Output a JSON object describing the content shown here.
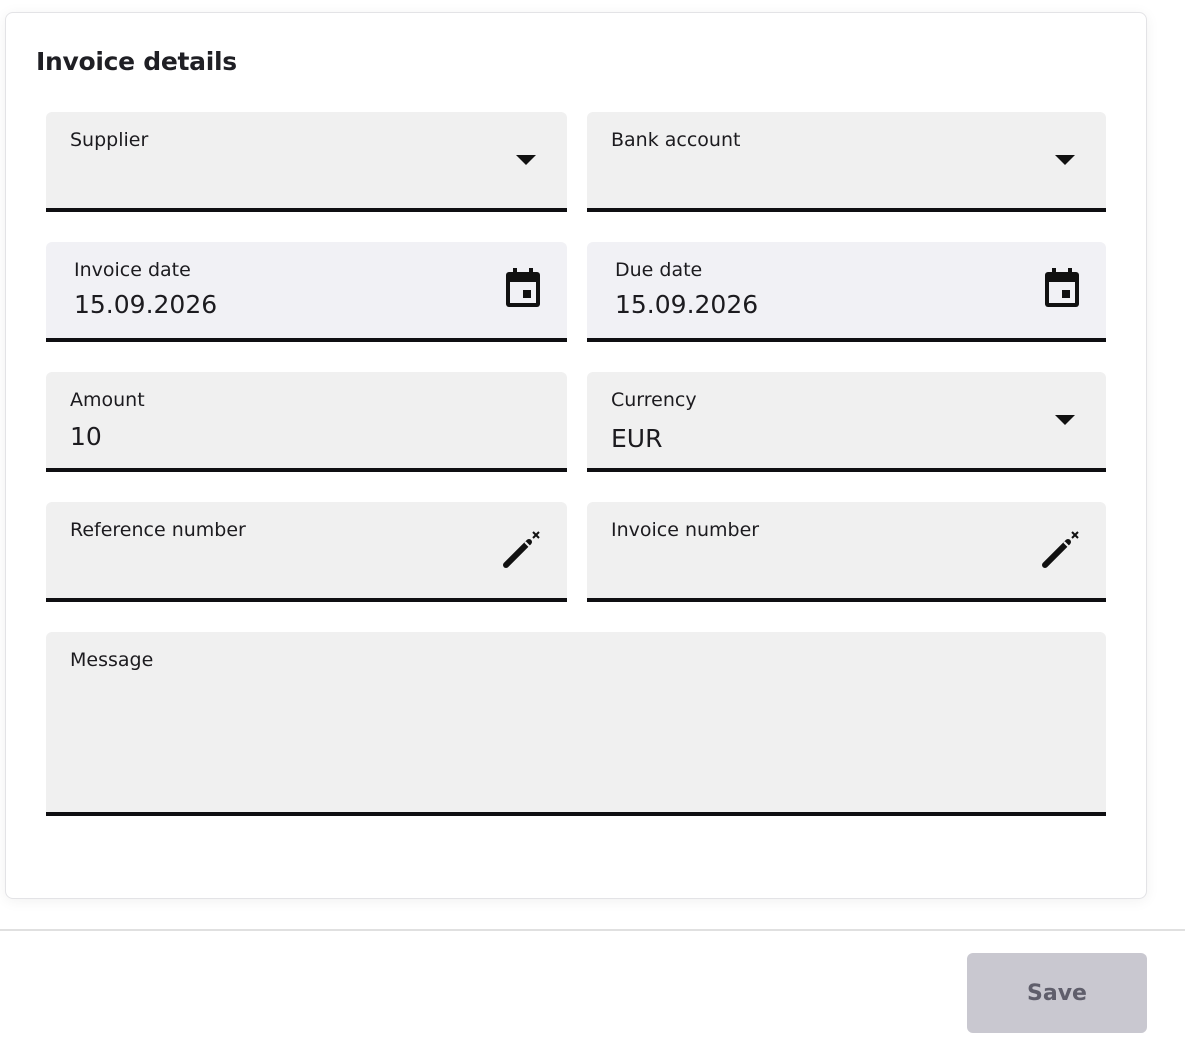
{
  "form": {
    "title": "Invoice details",
    "supplier": {
      "label": "Supplier",
      "value": ""
    },
    "bank_account": {
      "label": "Bank account",
      "value": ""
    },
    "invoice_date": {
      "label": "Invoice date",
      "value": "15.09.2026"
    },
    "due_date": {
      "label": "Due date",
      "value": "15.09.2026"
    },
    "amount": {
      "label": "Amount",
      "value": "10"
    },
    "currency": {
      "label": "Currency",
      "value": "EUR"
    },
    "reference_number": {
      "label": "Reference number",
      "value": ""
    },
    "invoice_number": {
      "label": "Invoice number",
      "value": ""
    },
    "message": {
      "label": "Message",
      "value": ""
    }
  },
  "footer": {
    "save_label": "Save"
  },
  "icons": {
    "dropdown": "chevron-down-icon",
    "calendar": "calendar-icon",
    "generate": "magic-wand-icon"
  },
  "colors": {
    "field_background": "#f0f0f0",
    "date_field_background": "#f1f1f5",
    "underline": "#0f0f12",
    "save_disabled_bg": "#c9c8d0",
    "save_disabled_text": "#5f5e6b"
  }
}
